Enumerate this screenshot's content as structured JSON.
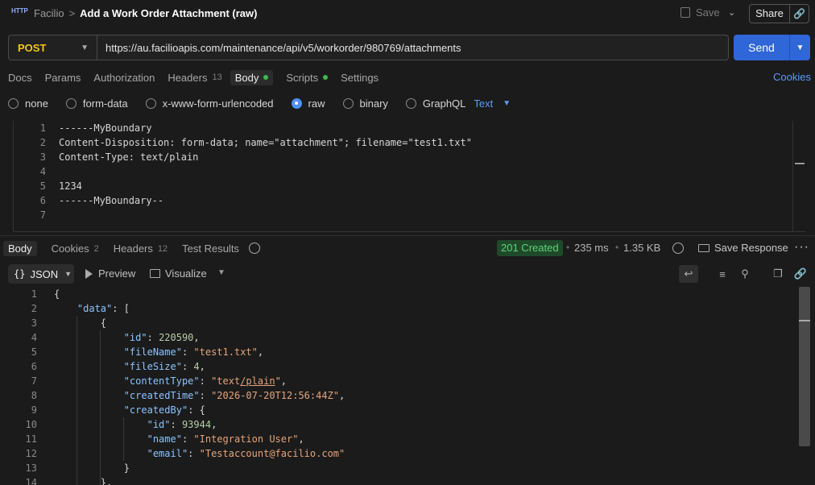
{
  "header": {
    "breadcrumb_root": "Facilio",
    "breadcrumb_sep": ">",
    "title": "Add a Work Order Attachment (raw)",
    "save_label": "Save",
    "share_label": "Share"
  },
  "request": {
    "method": "POST",
    "url": "https://au.facilioapis.com/maintenance/api/v5/workorder/980769/attachments",
    "send_label": "Send",
    "tabs": [
      {
        "label": "Docs"
      },
      {
        "label": "Params"
      },
      {
        "label": "Authorization"
      },
      {
        "label": "Headers",
        "count": "13"
      },
      {
        "label": "Body"
      },
      {
        "label": "Scripts"
      },
      {
        "label": "Settings"
      }
    ],
    "cookies_label": "Cookies",
    "body_types": [
      "none",
      "form-data",
      "x-www-form-urlencoded",
      "raw",
      "binary",
      "GraphQL"
    ],
    "raw_format": "Text",
    "body_lines": [
      {
        "n": "1",
        "text": "------MyBoundary"
      },
      {
        "n": "2",
        "text": "Content-Disposition: form-data; name=\"attachment\"; filename=\"test1.txt\""
      },
      {
        "n": "3",
        "text": "Content-Type: text/plain"
      },
      {
        "n": "4",
        "text": ""
      },
      {
        "n": "5",
        "text": "1234"
      },
      {
        "n": "6",
        "text": "------MyBoundary--"
      },
      {
        "n": "7",
        "text": ""
      }
    ]
  },
  "response": {
    "tabs": [
      {
        "label": "Body"
      },
      {
        "label": "Cookies",
        "count": "2"
      },
      {
        "label": "Headers",
        "count": "12"
      },
      {
        "label": "Test Results"
      }
    ],
    "status": "201 Created",
    "time": "235 ms",
    "size": "1.35 KB",
    "save_response_label": "Save Response",
    "format": "JSON",
    "preview_label": "Preview",
    "visualize_label": "Visualize",
    "line_numbers": [
      "1",
      "2",
      "3",
      "4",
      "5",
      "6",
      "7",
      "8",
      "9",
      "10",
      "11",
      "12",
      "13",
      "14"
    ],
    "json": {
      "id": "220590",
      "fileName": "\"test1.txt\"",
      "fileSize": "4",
      "contentType_a": "\"text",
      "contentType_b": "/plain",
      "contentType_c": "\"",
      "createdTime": "\"2026-07-20T12:56:44Z\"",
      "createdBy_id": "93944",
      "createdBy_name": "\"Integration User\"",
      "createdBy_email": "\"Testaccount@facilio.com\""
    }
  },
  "colors": {
    "accent": "#2f66d8",
    "method": "#f5c518",
    "status_ok": "#5fd37a",
    "dot": "#3fb950"
  }
}
